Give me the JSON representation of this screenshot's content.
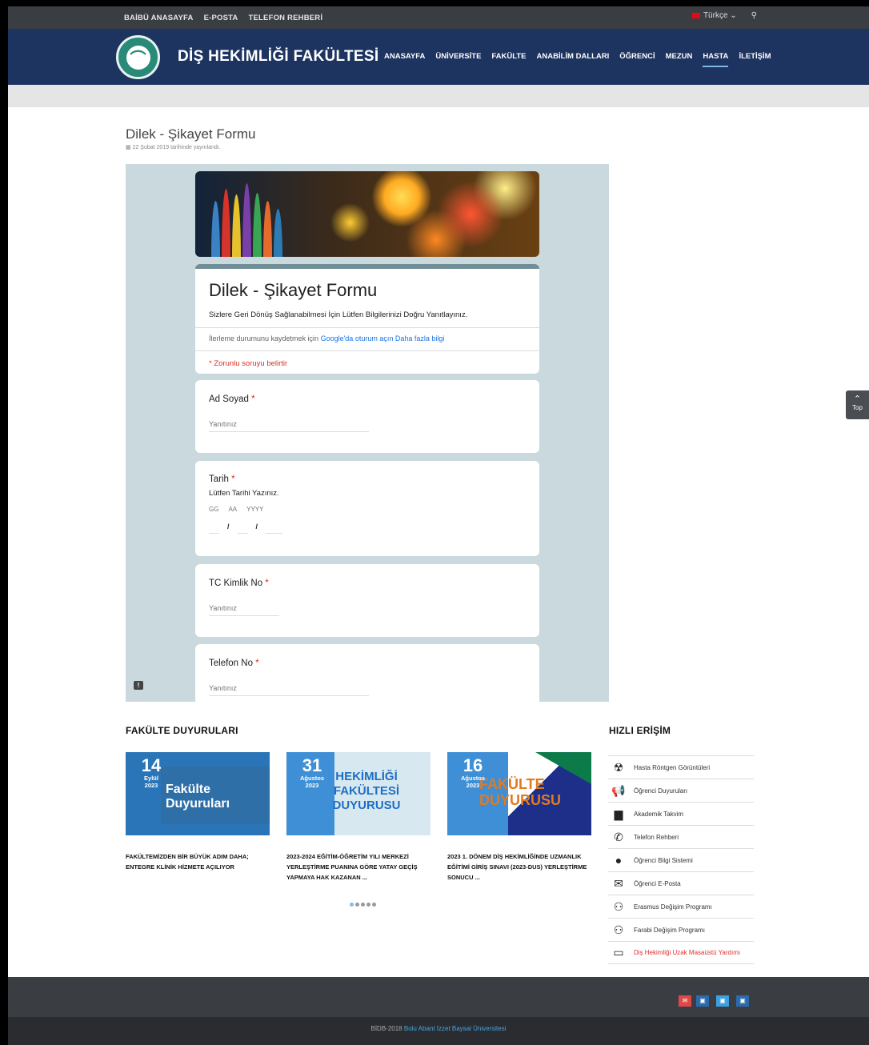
{
  "topbar": {
    "links": [
      "BAİBÜ ANASAYFA",
      "E-POSTA",
      "TELEFON REHBERİ"
    ],
    "language": "Türkçe"
  },
  "navbar": {
    "brand": "DİŞ HEKİMLİĞİ FAKÜLTESİ",
    "menu": [
      "ANASAYFA",
      "ÜNİVERSİTE",
      "FAKÜLTE",
      "ANABİLİM DALLARI",
      "ÖĞRENCİ",
      "MEZUN",
      "HASTA",
      "İLETİŞİM"
    ],
    "active": "HASTA"
  },
  "page": {
    "title": "Dilek - Şikayet Formu",
    "published": "22 Şubat 2019 tarihinde yayınlandı."
  },
  "form": {
    "title": "Dilek - Şikayet Formu",
    "description": "Sizlere Geri Dönüş Sağlanabilmesi İçin Lütfen  Bilgilerinizi Doğru Yanıtlayınız.",
    "login_text": "İlerleme durumunu kaydetmek için ",
    "login_link": "Google'da oturum açın",
    "more_info": "Daha fazla bilgi",
    "required_note": "* Zorunlu soruyu belirtir",
    "q1": {
      "label": "Ad Soyad",
      "placeholder": "Yanıtınız"
    },
    "q2": {
      "label": "Tarih",
      "help": "Lütfen Tarihi Yazınız.",
      "dd": "GG",
      "mm": "AA",
      "yyyy": "YYYY",
      "sep": "/"
    },
    "q3": {
      "label": "TC Kimlik No",
      "placeholder": "Yanıtınız"
    },
    "q4": {
      "label": "Telefon No",
      "placeholder": "Yanıtınız"
    },
    "required_mark": "*"
  },
  "top_button": "Top",
  "announcements": {
    "title": "FAKÜLTE DUYURULARI",
    "items": [
      {
        "day": "14",
        "month": "Eylül",
        "year": "2023",
        "image_text": "Fakülte Duyuruları",
        "caption": "FAKÜLTEMİZDEN BİR BÜYÜK ADIM DAHA; ENTEGRE KLİNİK HİZMETE AÇILIYOR"
      },
      {
        "day": "31",
        "month": "Ağustos",
        "year": "2023",
        "image_text": "HEKİMLİĞİ FAKÜLTESİ DUYURUSU",
        "caption": "2023-2024 EĞİTİM-ÖĞRETİM YILI MERKEZİ YERLEŞTİRME PUANINA GÖRE YATAY GEÇİŞ YAPMAYA HAK KAZANAN ..."
      },
      {
        "day": "16",
        "month": "Ağustos",
        "year": "2023",
        "image_text": "FAKÜLTE DUYURUSU",
        "caption": "2023 1. DÖNEM DİŞ HEKİMLİĞİNDE UZMANLIK EĞİTİMİ GİRİŞ SINAVI (2023-DUS) YERLEŞTİRME SONUCU ..."
      }
    ]
  },
  "quick_access": {
    "title": "HIZLI ERİŞİM",
    "items": [
      {
        "label": "Hasta Röntgen Görüntüleri",
        "icon": "radiation-icon"
      },
      {
        "label": "Öğrenci Duyuruları",
        "icon": "megaphone-icon"
      },
      {
        "label": "Akademik Takvim",
        "icon": "calendar-icon"
      },
      {
        "label": "Telefon Rehberi",
        "icon": "phone-icon"
      },
      {
        "label": "Öğrenci Bilgi Sistemi",
        "icon": "user-icon"
      },
      {
        "label": "Öğrenci E-Posta",
        "icon": "envelope-icon"
      },
      {
        "label": "Erasmus Değişim Programı",
        "icon": "users-icon"
      },
      {
        "label": "Farabi Değişim Programı",
        "icon": "users-icon"
      },
      {
        "label": "Diş Hekimliği Uzak Masaüstü Yardımı",
        "icon": "monitor-icon",
        "color": "#e03030"
      }
    ]
  },
  "footer": {
    "copyright_prefix": "BİDB-2018 ",
    "copyright_link": "Bolu Abant İzzet Baysal Üniversitesi"
  }
}
